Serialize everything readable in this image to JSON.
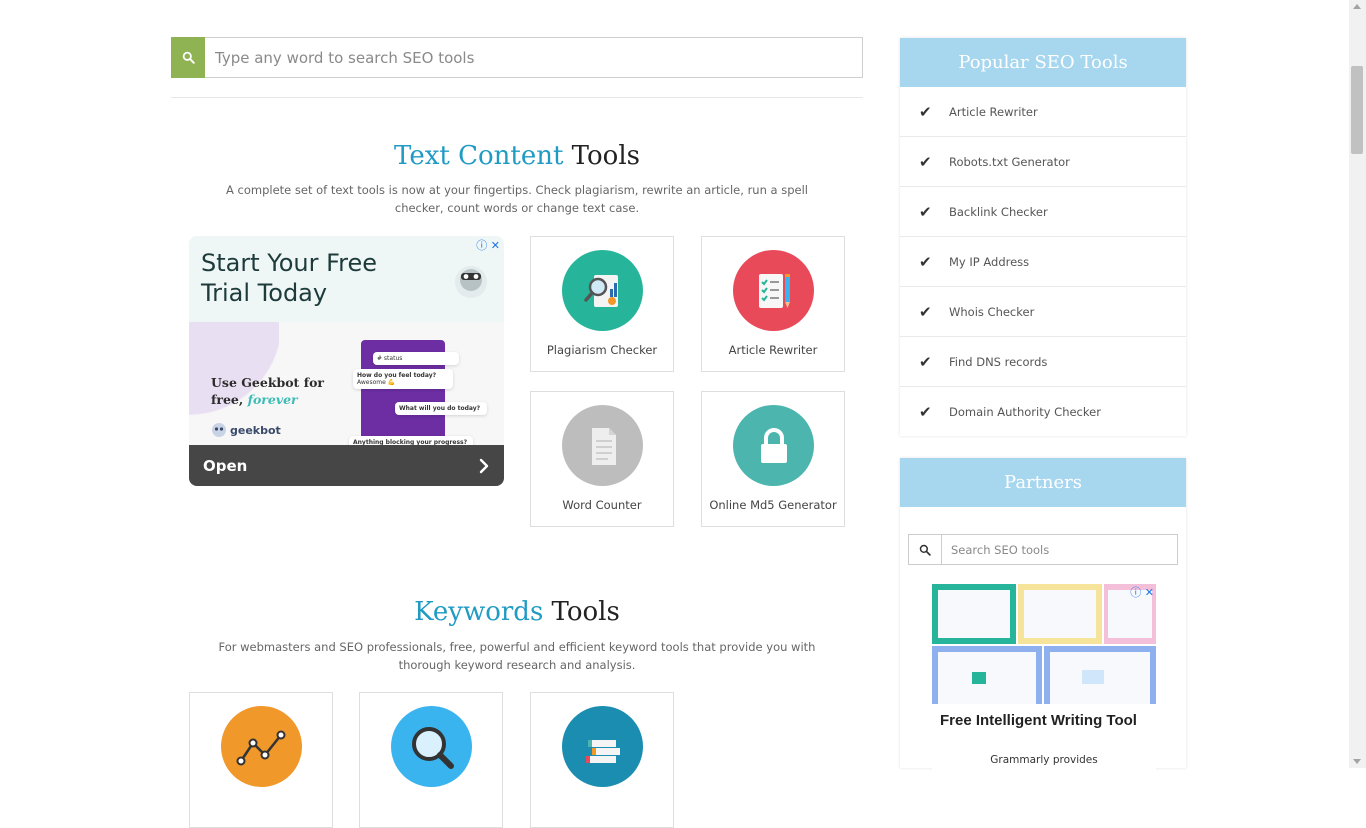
{
  "search": {
    "placeholder": "Type any word to search SEO tools",
    "icon": "search-icon"
  },
  "sections": {
    "text_content": {
      "title_accent": "Text Content",
      "title_rest": " Tools",
      "description": "A complete set of text tools is now at your fingertips. Check plagiarism, rewrite an article, run a spell checker, count words or change text case."
    },
    "keywords": {
      "title_accent": "Keywords",
      "title_rest": " Tools",
      "description": "For webmasters and SEO professionals, free, powerful and efficient keyword tools that provide you with thorough keyword research and analysis."
    }
  },
  "ad": {
    "headline": "Start Your Free Trial Today",
    "copy_line1": "Use Geekbot for",
    "copy_line2_prefix": "free, ",
    "copy_line2_highlight": "forever",
    "brand": "geekbot",
    "chat_1": "How do you feel today?",
    "chat_1_reply": "Awesome 💪",
    "chat_2": "What will you do today?",
    "chat_3": "Anything blocking your progress?",
    "status_tag": "# status",
    "cta": "Open"
  },
  "text_tools": [
    {
      "label": "Plagiarism Checker",
      "color": "#26b59a",
      "icon": "plagiarism-icon"
    },
    {
      "label": "Article Rewriter",
      "color": "#e84a5a",
      "icon": "checklist-icon"
    },
    {
      "label": "Word Counter",
      "color": "#bdbdbd",
      "icon": "document-icon"
    },
    {
      "label": "Online Md5 Generator",
      "color": "#4bb5ae",
      "icon": "lock-icon"
    }
  ],
  "keyword_tools": [
    {
      "color": "#f0982a",
      "icon": "line-chart-icon"
    },
    {
      "color": "#3ab4ee",
      "icon": "www-search-icon"
    },
    {
      "color": "#1a8db0",
      "icon": "books-icon"
    }
  ],
  "sidebar": {
    "popular_title": "Popular SEO Tools",
    "popular_items": [
      "Article Rewriter",
      "Robots.txt Generator",
      "Backlink Checker",
      "My IP Address",
      "Whois Checker",
      "Find DNS records",
      "Domain Authority Checker"
    ],
    "partners_title": "Partners",
    "partners_search_placeholder": "Search SEO tools",
    "partner_ad_title": "Free Intelligent Writing Tool",
    "partner_ad_sub": "Grammarly provides"
  },
  "colors": {
    "accent": "#1f9bc4",
    "search_button": "#8fb253",
    "panel_header": "#a7d6ef"
  }
}
